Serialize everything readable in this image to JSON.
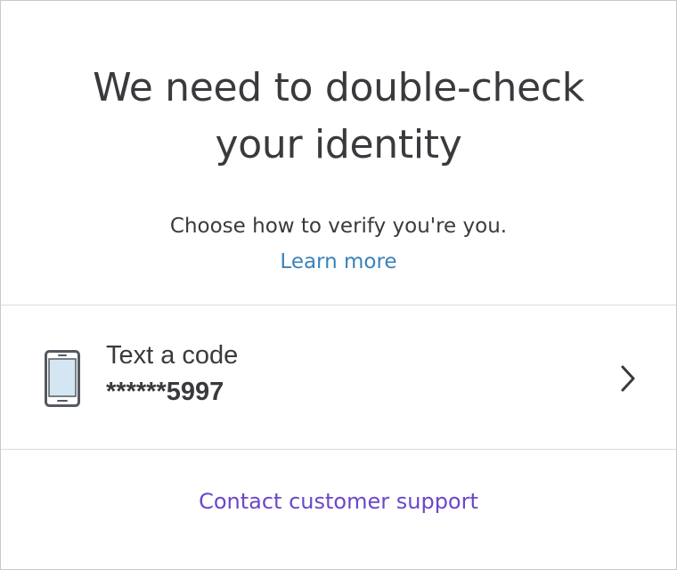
{
  "header": {
    "title": "We need to double-check your identity",
    "subtitle": "Choose how to verify you're you.",
    "learn_more": "Learn more"
  },
  "options": [
    {
      "label": "Text a code",
      "value": "******5997",
      "icon": "phone-icon"
    }
  ],
  "footer": {
    "support_link": "Contact customer support"
  },
  "colors": {
    "text": "#393a3d",
    "link_blue": "#3b83b8",
    "link_purple": "#6b47c9",
    "phone_screen": "#d4e6f2",
    "divider": "#dcdcdc"
  }
}
